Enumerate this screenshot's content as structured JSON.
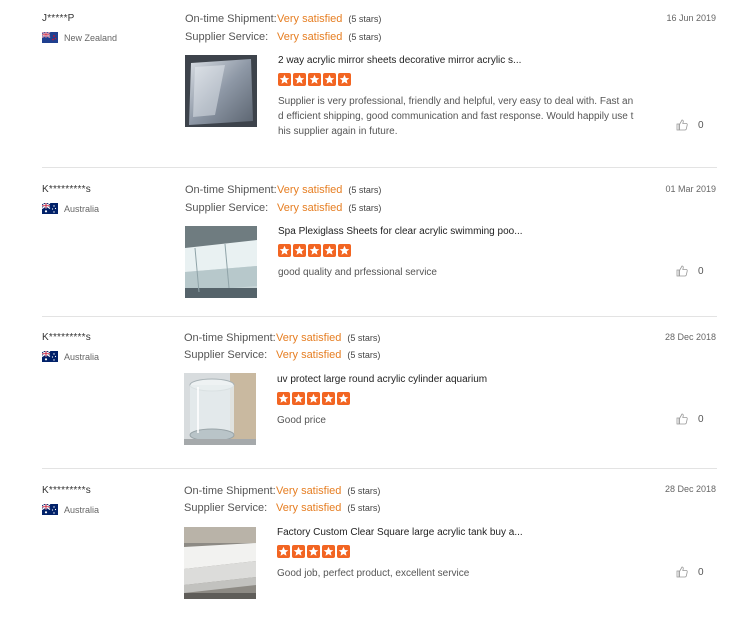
{
  "reviews": [
    {
      "user": "J*****P",
      "country": "New Zealand",
      "date": "16 Jun 2019",
      "metrics": [
        {
          "label": "On-time Shipment:",
          "value": "Very satisfied",
          "stars": "(5 stars)"
        },
        {
          "label": "Supplier Service:",
          "value": "Very satisfied",
          "stars": "(5 stars)"
        }
      ],
      "product": "2 way acrylic mirror sheets decorative mirror acrylic s...",
      "rating": 5,
      "comment": "Supplier is very professional, friendly and helpful, very easy to deal with. Fast and efficient shipping, good communication and fast response. Would happily use this supplier again in future.",
      "likes": "0",
      "thumb": "mirror"
    },
    {
      "user": "K*********s",
      "country": "Australia",
      "date": "01 Mar 2019",
      "metrics": [
        {
          "label": "On-time Shipment:",
          "value": "Very satisfied",
          "stars": "(5 stars)"
        },
        {
          "label": "Supplier Service:",
          "value": "Very satisfied",
          "stars": "(5 stars)"
        }
      ],
      "product": "Spa Plexiglass Sheets for clear acrylic swimming poo...",
      "rating": 5,
      "comment": "good quality and prfessional service",
      "likes": "0",
      "thumb": "sheets"
    },
    {
      "user": "K*********s",
      "country": "Australia",
      "date": "28 Dec 2018",
      "metrics": [
        {
          "label": "On-time Shipment:",
          "value": "Very satisfied",
          "stars": "(5 stars)"
        },
        {
          "label": "Supplier Service:",
          "value": "Very satisfied",
          "stars": "(5 stars)"
        }
      ],
      "product": "uv protect large round acrylic cylinder aquarium",
      "rating": 5,
      "comment": "Good price",
      "likes": "0",
      "thumb": "cylinder"
    },
    {
      "user": "K*********s",
      "country": "Australia",
      "date": "28 Dec 2018",
      "metrics": [
        {
          "label": "On-time Shipment:",
          "value": "Very satisfied",
          "stars": "(5 stars)"
        },
        {
          "label": "Supplier Service:",
          "value": "Very satisfied",
          "stars": "(5 stars)"
        }
      ],
      "product": "Factory Custom Clear Square large acrylic tank buy a...",
      "rating": 5,
      "comment": "Good job, perfect product, excellent service",
      "likes": "0",
      "thumb": "tank"
    }
  ],
  "colors": {
    "accent": "#e67e22",
    "star": "#f26522",
    "divider": "#e3e3e3"
  }
}
